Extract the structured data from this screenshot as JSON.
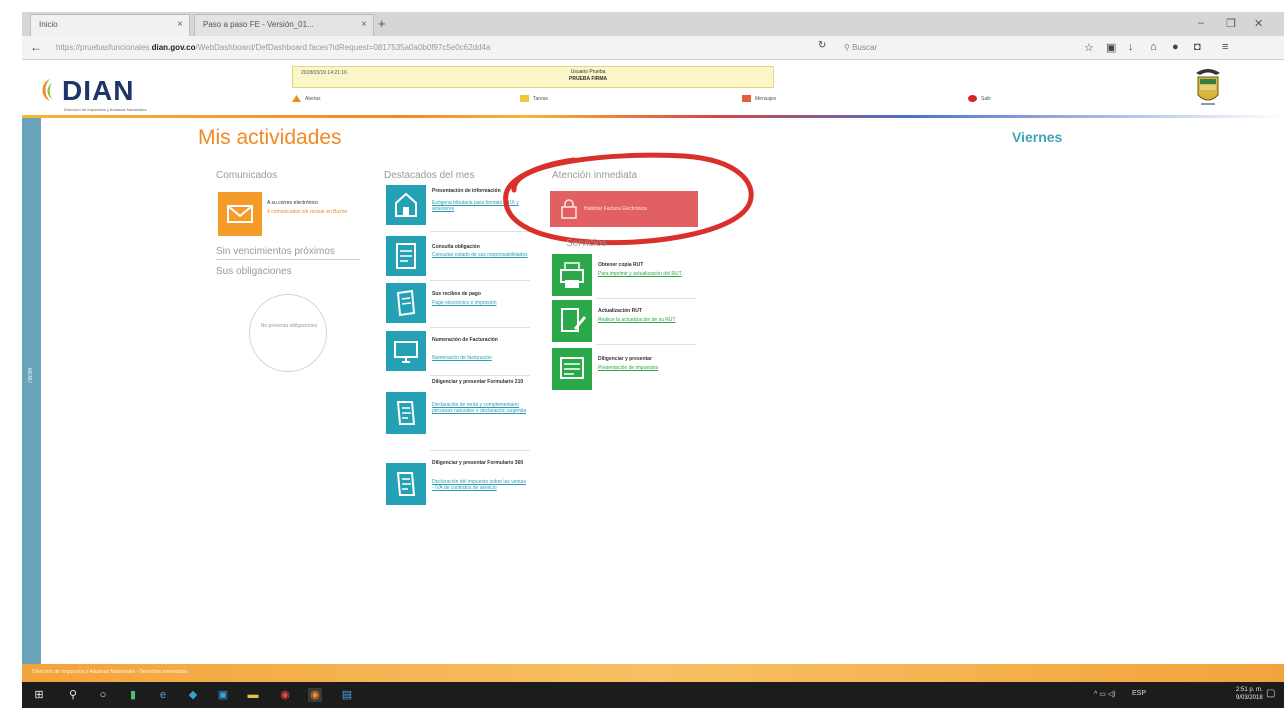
{
  "browser": {
    "tabs": [
      {
        "label": "Inicio"
      },
      {
        "label": "Paso a paso FE - Versión_01..."
      }
    ],
    "url": {
      "prefix": "https://pruebasfuncionales.",
      "domain": "dian.gov.co",
      "rest": "/WebDashboard/DefDashboard.faces?idRequest=0817535a0a0b0f97c5e0c62dd4a"
    },
    "search_placeholder": "Buscar",
    "win_controls": [
      "–",
      "❐",
      "✕"
    ],
    "nav": {
      "back": "←",
      "reload": "↻"
    }
  },
  "header": {
    "logo": "DIAN",
    "logo_subtitle": "Dirección de Impuestos y Aduanas Nacionales",
    "datetime": "2018/03/19 14:21:16",
    "user_line1": "Usuario Prueba",
    "user_line2": "PRUEBA FIRMA",
    "menu": [
      {
        "label": "Alertas",
        "color": "#f08a24"
      },
      {
        "label": "Tareas",
        "color": "#f3c53b"
      },
      {
        "label": "Mensajes",
        "color": "#e25f3f"
      },
      {
        "label": "Salir",
        "color": "#d0262b"
      }
    ]
  },
  "sidebar": {
    "label": "MENÚ"
  },
  "main": {
    "title": "Mis actividades",
    "day": "Viernes",
    "comunicados": {
      "heading": "Comunicados",
      "item_title": "A su correo electrónico",
      "item_sub": "4 comunicados sin revisar en Buzón",
      "vencimientos": "Sin vencimientos próximos",
      "obligaciones": "Sus obligaciones",
      "circle_text": "No presenta obligaciones"
    },
    "destacados": {
      "heading": "Destacados del mes",
      "cards": [
        {
          "title": "Presentación de información",
          "link": "Exógena tributaria para formato 2016 y anteriores"
        },
        {
          "title": "Consulta obligación",
          "link": "Consultar estado de sus responsabilidades"
        },
        {
          "title": "Sus recibos de pago",
          "link": "Pago electrónico e impresión"
        },
        {
          "title": "Numeración de Facturación",
          "link": "Numeración de facturación"
        },
        {
          "title": "Diligenciar y presentar Formulario 210",
          "link": "Declaración de renta y complementario personas naturales e declaración sugerida"
        },
        {
          "title": "Diligenciar y presentar Formulario 300",
          "link": "Declaración del impuesto sobre las ventas - IVA de contratos de servicio"
        }
      ]
    },
    "atencion": {
      "heading": "Atención inmediata",
      "button": "Habilitar Factura Electrónica",
      "sub_heading": "Servicios",
      "cards": [
        {
          "title": "Obtener copia RUT",
          "link": "Para imprimir y actualización del RUT"
        },
        {
          "title": "Actualización RUT",
          "link": "Realice la actualización de su RUT"
        },
        {
          "title": "Diligenciar y presentar",
          "link": "Presentación de impuestos"
        }
      ]
    }
  },
  "footer": {
    "text": "Dirección de Impuestos y Aduanas Nacionales - Derechos reservados"
  },
  "taskbar": {
    "tray_text": "ESP",
    "time": "2:51 p. m.",
    "date": "9/03/2018"
  },
  "colors": {
    "accent": "#f08a24",
    "teal": "#24a1b5",
    "green": "#2ba84a",
    "red": "#e25f63",
    "navy": "#1e3667"
  }
}
